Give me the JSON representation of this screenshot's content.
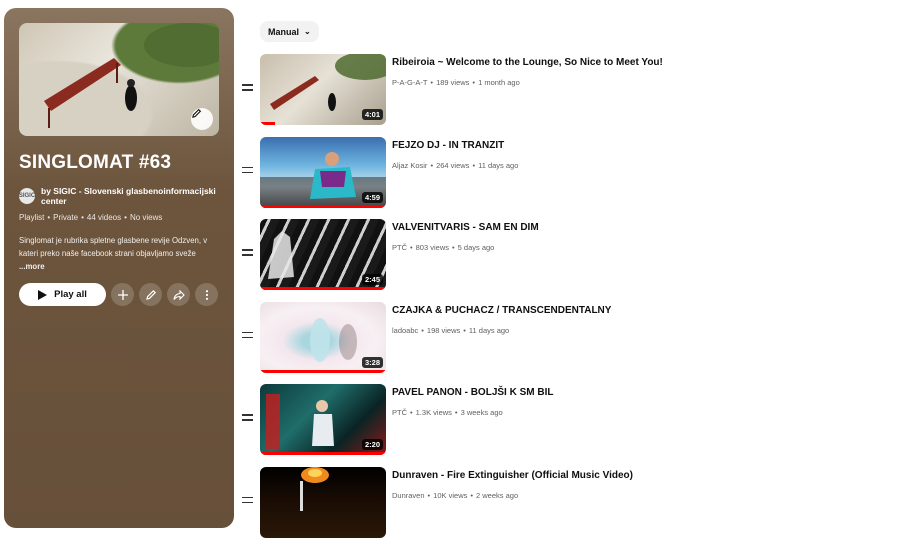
{
  "playlist": {
    "title": "SINGLOMAT #63",
    "owner": "by SIGIC - Slovenski glasbenoinformacijski center",
    "avatar_text": "SIGIC",
    "type": "Playlist",
    "privacy": "Private",
    "video_count": "44 videos",
    "views": "No views",
    "description": "Singlomat je rubrika spletne glasbene revije Odzven, v kateri preko naše facebook strani objavljamo sveže",
    "more_label": "...more",
    "play_all_label": "Play all"
  },
  "sort": {
    "label": "Manual"
  },
  "videos": [
    {
      "title": "Ribeiroia ~ Welcome to the Lounge, So Nice to Meet You!",
      "channel": "P-A-G-A-T",
      "views": "189 views",
      "age": "1 month ago",
      "duration": "4:01",
      "watched": 0.12
    },
    {
      "title": "FEJZO DJ - IN TRANZIT",
      "channel": "Aljaz Kosir",
      "views": "264 views",
      "age": "11 days ago",
      "duration": "4:59",
      "watched": 1.0
    },
    {
      "title": "VALVENITVARIS - SAM EN DIM",
      "channel": "PTČ",
      "views": "803 views",
      "age": "5 days ago",
      "duration": "2:45",
      "watched": 1.0
    },
    {
      "title": "CZAJKA & PUCHACZ / TRANSCENDENTALNY",
      "channel": "ladoabc",
      "views": "198 views",
      "age": "11 days ago",
      "duration": "3:28",
      "watched": 1.0
    },
    {
      "title": "PAVEL PANON - BOLJŠI K SM BIL",
      "channel": "PTČ",
      "views": "1.3K views",
      "age": "3 weeks ago",
      "duration": "2:20",
      "watched": 1.0
    },
    {
      "title": "Dunraven - Fire Extinguisher (Official Music Video)",
      "channel": "Dunraven",
      "views": "10K views",
      "age": "2 weeks ago",
      "duration": "",
      "watched": 0
    }
  ]
}
